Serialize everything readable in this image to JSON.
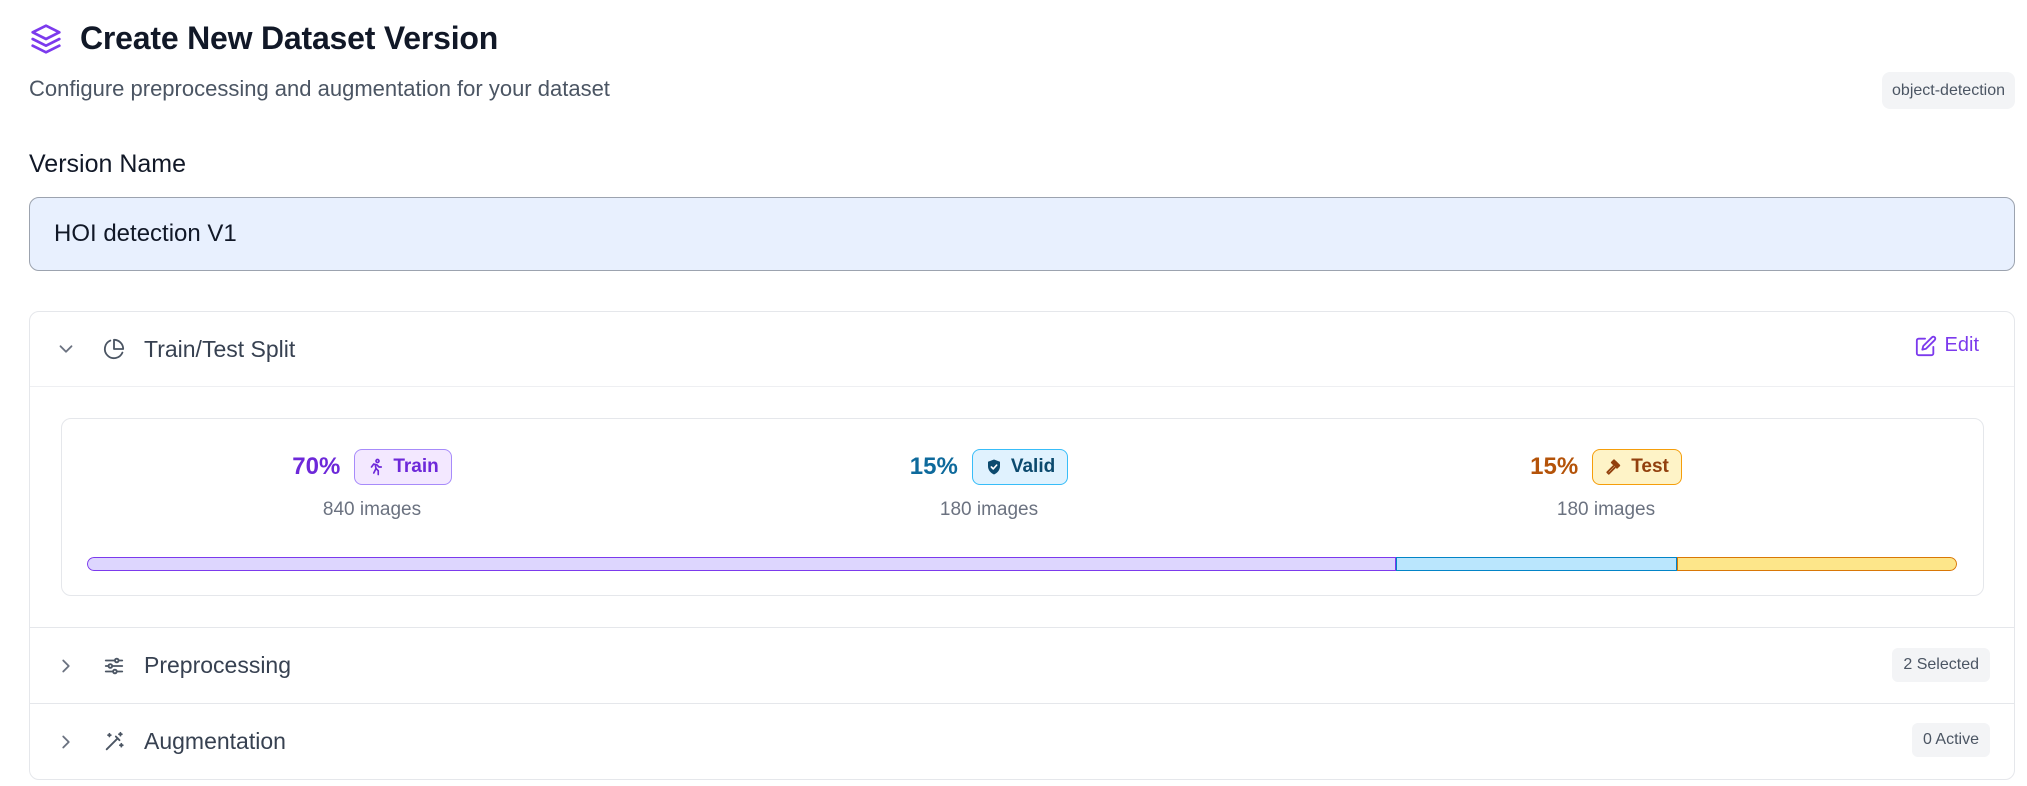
{
  "header": {
    "title": "Create New Dataset Version",
    "subtitle": "Configure preprocessing and augmentation for your dataset",
    "task_badge": "object-detection",
    "icon": "layers-icon",
    "accent": "#7c3aed"
  },
  "version": {
    "label": "Version Name",
    "value": "HOI detection V1"
  },
  "split_section": {
    "title": "Train/Test Split",
    "edit_label": "Edit",
    "splits": [
      {
        "percent_label": "70%",
        "name": "Train",
        "images": "840 images",
        "fraction": 0.7,
        "color": "#6d28d9",
        "icon": "runner-icon"
      },
      {
        "percent_label": "15%",
        "name": "Valid",
        "images": "180 images",
        "fraction": 0.15,
        "color": "#0e6a9c",
        "icon": "shield-check-icon"
      },
      {
        "percent_label": "15%",
        "name": "Test",
        "images": "180 images",
        "fraction": 0.15,
        "color": "#b45309",
        "icon": "hammer-icon"
      }
    ]
  },
  "preprocessing": {
    "title": "Preprocessing",
    "badge": "2 Selected"
  },
  "augmentation": {
    "title": "Augmentation",
    "badge": "0 Active"
  }
}
